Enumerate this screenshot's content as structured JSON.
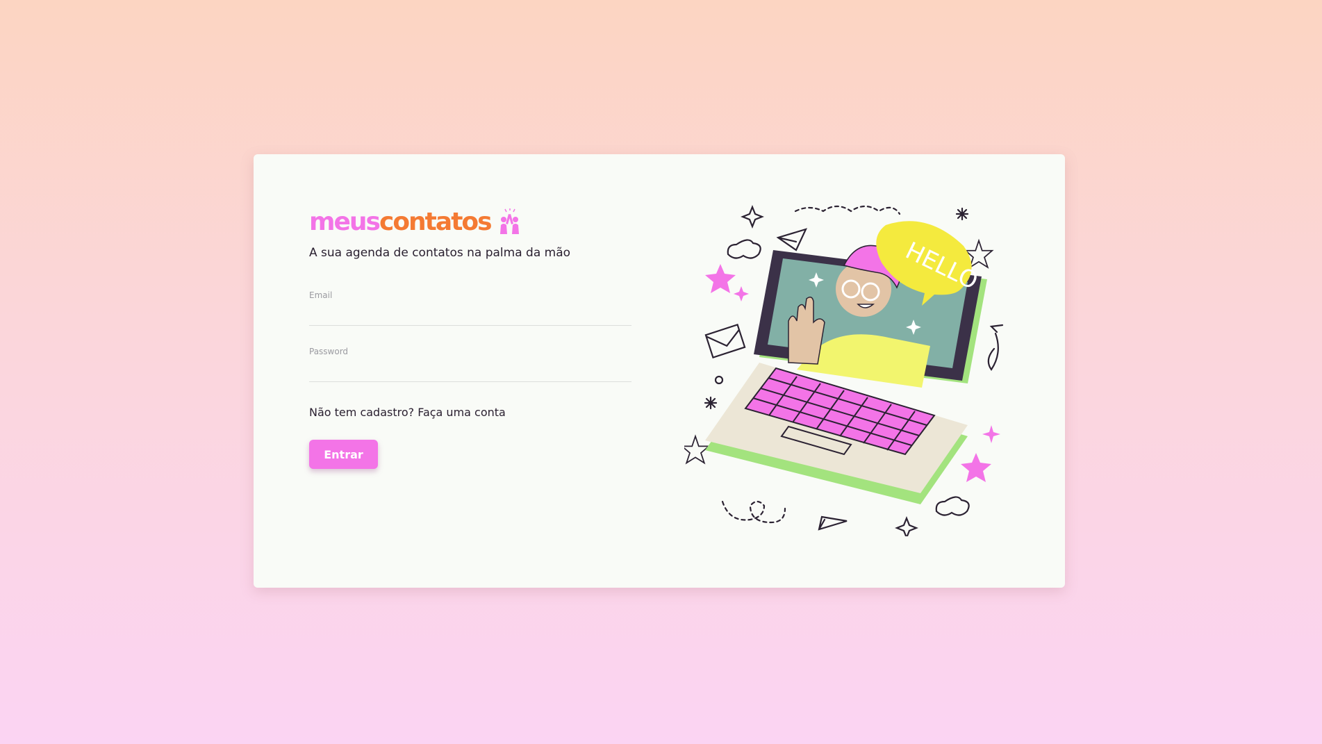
{
  "brand": {
    "name_part1": "meus",
    "name_part2": "contatos",
    "icon": "high-five-icon",
    "colors": {
      "pink": "#f374e7",
      "orange": "#f47a33"
    }
  },
  "tagline": "A sua agenda de contatos na palma da mão",
  "form": {
    "email_label": "Email",
    "email_value": "",
    "password_label": "Password",
    "password_value": "",
    "signup_text": "Não tem cadastro? Faça uma conta",
    "submit_label": "Entrar"
  },
  "illustration": {
    "icon": "laptop-hello-illustration",
    "speech_bubble": "HELLO"
  }
}
